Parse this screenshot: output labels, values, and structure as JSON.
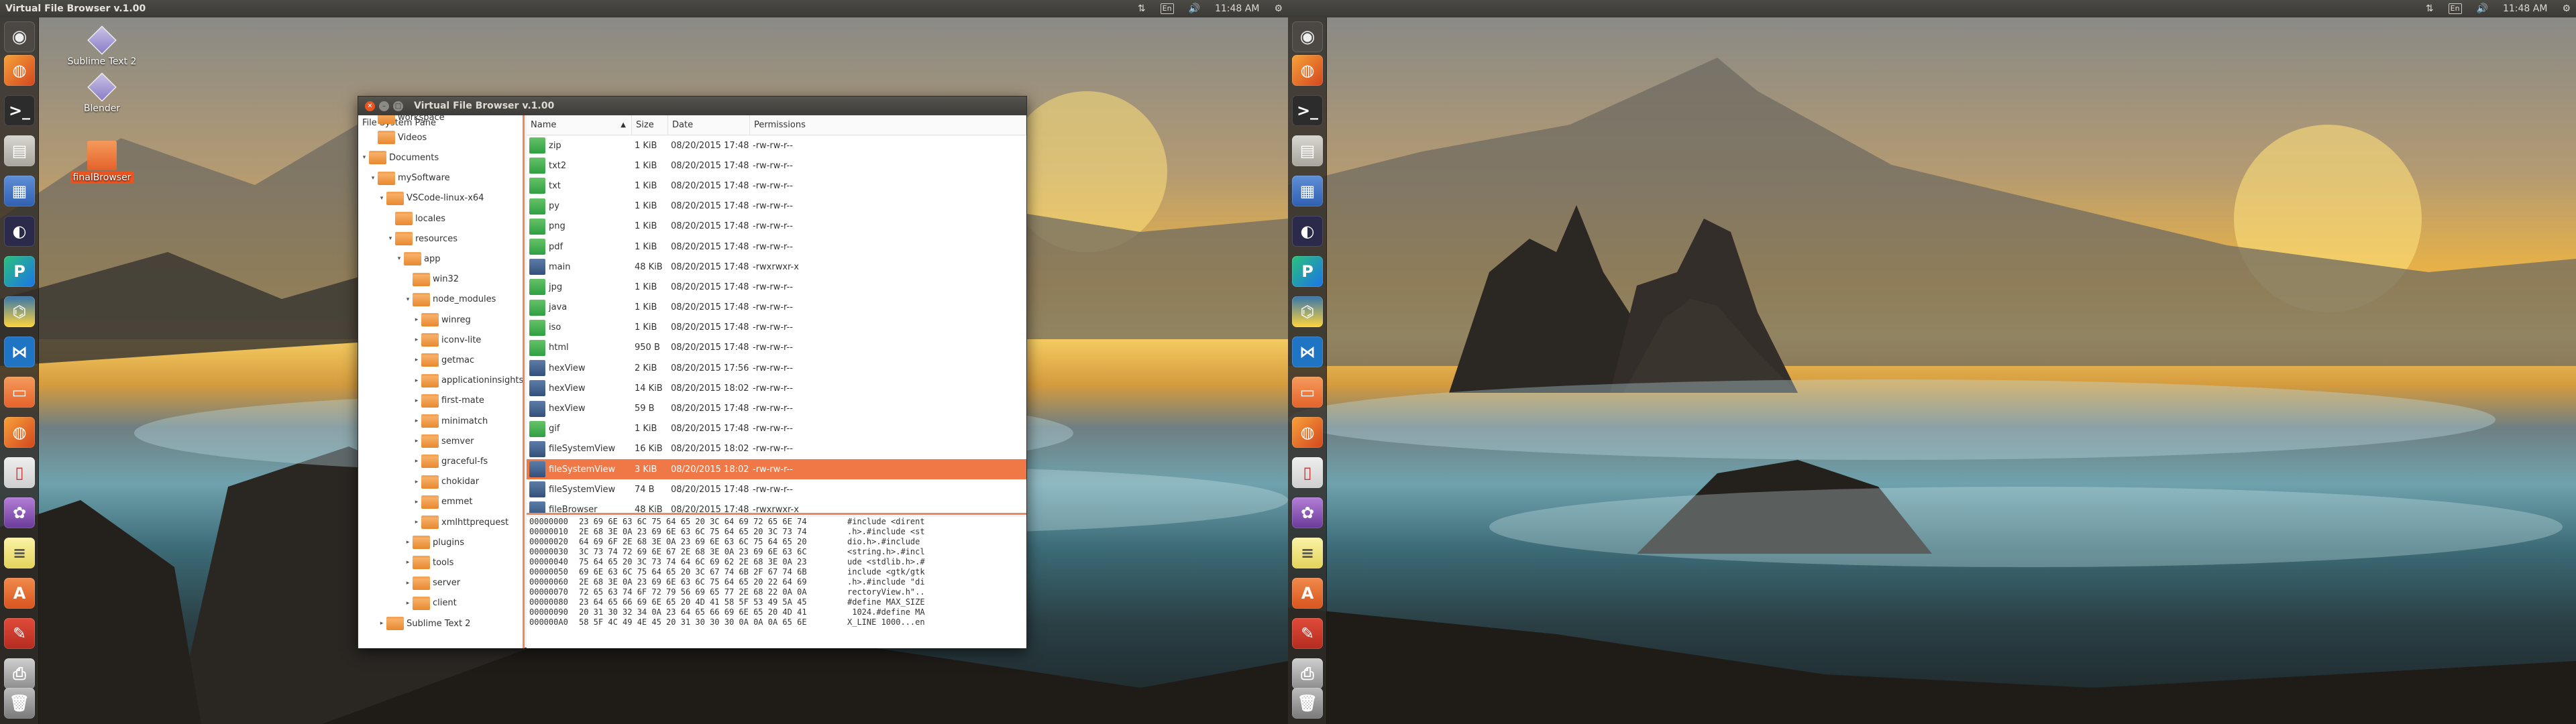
{
  "top_bar": {
    "active_window_title": "Virtual File Browser v.1.00",
    "clock": "11:48 AM",
    "keyboard_layout": "En"
  },
  "desktop_icons": [
    {
      "label": "Sublime Text 2",
      "icon": "sublime-text-icon"
    },
    {
      "label": "Blender",
      "icon": "blender-icon"
    },
    {
      "label": "finalBrowser",
      "icon": "folder-icon",
      "selected": true
    }
  ],
  "launcher": [
    {
      "name": "dash-icon"
    },
    {
      "name": "firefox-icon"
    },
    {
      "name": "terminal-icon"
    },
    {
      "name": "files-icon"
    },
    {
      "name": "text-editor-icon"
    },
    {
      "name": "eclipse-icon"
    },
    {
      "name": "pycharm-icon"
    },
    {
      "name": "python-icon"
    },
    {
      "name": "vscode-icon"
    },
    {
      "name": "folder-icon"
    },
    {
      "name": "firefox-dev-icon"
    },
    {
      "name": "document-viewer-icon"
    },
    {
      "name": "purple-app-icon"
    },
    {
      "name": "notes-icon"
    },
    {
      "name": "font-viewer-icon"
    },
    {
      "name": "settings-icon"
    },
    {
      "name": "printer-icon"
    },
    {
      "name": "trash-icon"
    }
  ],
  "window": {
    "title": "Virtual File Browser v.1.00",
    "tree_pane_title": "File System Pane",
    "tree": [
      {
        "label": "workspace",
        "level": 1,
        "arrow": ""
      },
      {
        "label": "Videos",
        "level": 1,
        "arrow": ""
      },
      {
        "label": "Documents",
        "level": 0,
        "arrow": "▾"
      },
      {
        "label": "mySoftware",
        "level": 1,
        "arrow": "▾"
      },
      {
        "label": "VSCode-linux-x64",
        "level": 2,
        "arrow": "▾"
      },
      {
        "label": "locales",
        "level": 3,
        "arrow": ""
      },
      {
        "label": "resources",
        "level": 3,
        "arrow": "▾"
      },
      {
        "label": "app",
        "level": 4,
        "arrow": "▾"
      },
      {
        "label": "win32",
        "level": 5,
        "arrow": ""
      },
      {
        "label": "node_modules",
        "level": 5,
        "arrow": "▾"
      },
      {
        "label": "winreg",
        "level": 6,
        "arrow": "▸"
      },
      {
        "label": "iconv-lite",
        "level": 6,
        "arrow": "▸"
      },
      {
        "label": "getmac",
        "level": 6,
        "arrow": "▸"
      },
      {
        "label": "applicationinsights",
        "level": 6,
        "arrow": "▸"
      },
      {
        "label": "first-mate",
        "level": 6,
        "arrow": "▸"
      },
      {
        "label": "minimatch",
        "level": 6,
        "arrow": "▸"
      },
      {
        "label": "semver",
        "level": 6,
        "arrow": "▸"
      },
      {
        "label": "graceful-fs",
        "level": 6,
        "arrow": "▸"
      },
      {
        "label": "chokidar",
        "level": 6,
        "arrow": "▸"
      },
      {
        "label": "emmet",
        "level": 6,
        "arrow": "▸"
      },
      {
        "label": "xmlhttprequest",
        "level": 6,
        "arrow": "▸"
      },
      {
        "label": "plugins",
        "level": 5,
        "arrow": "▸"
      },
      {
        "label": "tools",
        "level": 5,
        "arrow": "▸"
      },
      {
        "label": "server",
        "level": 5,
        "arrow": "▸"
      },
      {
        "label": "client",
        "level": 5,
        "arrow": "▸"
      },
      {
        "label": "Sublime Text 2",
        "level": 2,
        "arrow": "▸"
      }
    ],
    "columns": {
      "name": "Name",
      "size": "Size",
      "date": "Date",
      "permissions": "Permissions"
    },
    "files": [
      {
        "name": "zip",
        "size": "1 KiB",
        "date": "08/20/2015 17:48",
        "perm": "-rw-rw-r--",
        "icon": "green"
      },
      {
        "name": "txt2",
        "size": "1 KiB",
        "date": "08/20/2015 17:48",
        "perm": "-rw-rw-r--",
        "icon": "green"
      },
      {
        "name": "txt",
        "size": "1 KiB",
        "date": "08/20/2015 17:48",
        "perm": "-rw-rw-r--",
        "icon": "green"
      },
      {
        "name": "py",
        "size": "1 KiB",
        "date": "08/20/2015 17:48",
        "perm": "-rw-rw-r--",
        "icon": "green"
      },
      {
        "name": "png",
        "size": "1 KiB",
        "date": "08/20/2015 17:48",
        "perm": "-rw-rw-r--",
        "icon": "green"
      },
      {
        "name": "pdf",
        "size": "1 KiB",
        "date": "08/20/2015 17:48",
        "perm": "-rw-rw-r--",
        "icon": "green"
      },
      {
        "name": "main",
        "size": "48 KiB",
        "date": "08/20/2015 17:48",
        "perm": "-rwxrwxr-x",
        "icon": "blue"
      },
      {
        "name": "jpg",
        "size": "1 KiB",
        "date": "08/20/2015 17:48",
        "perm": "-rw-rw-r--",
        "icon": "green"
      },
      {
        "name": "java",
        "size": "1 KiB",
        "date": "08/20/2015 17:48",
        "perm": "-rw-rw-r--",
        "icon": "green"
      },
      {
        "name": "iso",
        "size": "1 KiB",
        "date": "08/20/2015 17:48",
        "perm": "-rw-rw-r--",
        "icon": "green"
      },
      {
        "name": "html",
        "size": "950 B",
        "date": "08/20/2015 17:48",
        "perm": "-rw-rw-r--",
        "icon": "green"
      },
      {
        "name": "hexView",
        "size": "2 KiB",
        "date": "08/20/2015 17:56",
        "perm": "-rw-rw-r--",
        "icon": "blue"
      },
      {
        "name": "hexView",
        "size": "14 KiB",
        "date": "08/20/2015 18:02",
        "perm": "-rw-rw-r--",
        "icon": "blue"
      },
      {
        "name": "hexView",
        "size": "59 B",
        "date": "08/20/2015 17:48",
        "perm": "-rw-rw-r--",
        "icon": "blue"
      },
      {
        "name": "gif",
        "size": "1 KiB",
        "date": "08/20/2015 17:48",
        "perm": "-rw-rw-r--",
        "icon": "green"
      },
      {
        "name": "fileSystemView",
        "size": "16 KiB",
        "date": "08/20/2015 18:02",
        "perm": "-rw-rw-r--",
        "icon": "blue"
      },
      {
        "name": "fileSystemView",
        "size": "3 KiB",
        "date": "08/20/2015 18:02",
        "perm": "-rw-rw-r--",
        "icon": "blue",
        "selected": true
      },
      {
        "name": "fileSystemView",
        "size": "74 B",
        "date": "08/20/2015 17:48",
        "perm": "-rw-rw-r--",
        "icon": "blue"
      },
      {
        "name": "fileBrowser",
        "size": "48 KiB",
        "date": "08/20/2015 17:48",
        "perm": "-rwxrwxr-x",
        "icon": "blue"
      }
    ],
    "hex": [
      {
        "off": "00000000",
        "bytes": "23 69 6E 63 6C 75 64 65 20 3C 64 69 72 65 6E 74",
        "ascii": "#include <dirent"
      },
      {
        "off": "00000010",
        "bytes": "2E 68 3E 0A 23 69 6E 63 6C 75 64 65 20 3C 73 74",
        "ascii": ".h>.#include <st"
      },
      {
        "off": "00000020",
        "bytes": "64 69 6F 2E 68 3E 0A 23 69 6E 63 6C 75 64 65 20",
        "ascii": "dio.h>.#include "
      },
      {
        "off": "00000030",
        "bytes": "3C 73 74 72 69 6E 67 2E 68 3E 0A 23 69 6E 63 6C",
        "ascii": "<string.h>.#incl"
      },
      {
        "off": "00000040",
        "bytes": "75 64 65 20 3C 73 74 64 6C 69 62 2E 68 3E 0A 23",
        "ascii": "ude <stdlib.h>.#"
      },
      {
        "off": "00000050",
        "bytes": "69 6E 63 6C 75 64 65 20 3C 67 74 6B 2F 67 74 6B",
        "ascii": "include <gtk/gtk"
      },
      {
        "off": "00000060",
        "bytes": "2E 68 3E 0A 23 69 6E 63 6C 75 64 65 20 22 64 69",
        "ascii": ".h>.#include \"di"
      },
      {
        "off": "00000070",
        "bytes": "72 65 63 74 6F 72 79 56 69 65 77 2E 68 22 0A 0A",
        "ascii": "rectoryView.h\".."
      },
      {
        "off": "00000080",
        "bytes": "23 64 65 66 69 6E 65 20 4D 41 58 5F 53 49 5A 45",
        "ascii": "#define MAX_SIZE"
      },
      {
        "off": "00000090",
        "bytes": "20 31 30 32 34 0A 23 64 65 66 69 6E 65 20 4D 41",
        "ascii": " 1024.#define MA"
      },
      {
        "off": "000000A0",
        "bytes": "58 5F 4C 49 4E 45 20 31 30 30 30 0A 0A 0A 65 6E",
        "ascii": "X_LINE 1000...en"
      }
    ]
  }
}
